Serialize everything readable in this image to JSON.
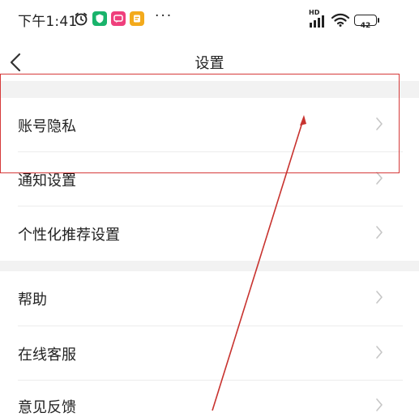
{
  "status_bar": {
    "time": "下午1:41",
    "icons": [
      "alarm-icon",
      "security-app-icon",
      "message-app-icon",
      "notes-app-icon"
    ],
    "more": "···",
    "network": "HD",
    "battery": "42"
  },
  "nav": {
    "title": "设置",
    "back_icon": "chevron-left-icon"
  },
  "settings": {
    "groups": [
      [
        {
          "label": "账号隐私"
        },
        {
          "label": "通知设置"
        },
        {
          "label": "个性化推荐设置"
        }
      ],
      [
        {
          "label": "帮助"
        },
        {
          "label": "在线客服"
        },
        {
          "label": "意见反馈"
        }
      ]
    ]
  },
  "colors": {
    "annotation": "#d63a3a",
    "section_gap": "#f2f2f2",
    "chevron": "#c6c6c6"
  }
}
